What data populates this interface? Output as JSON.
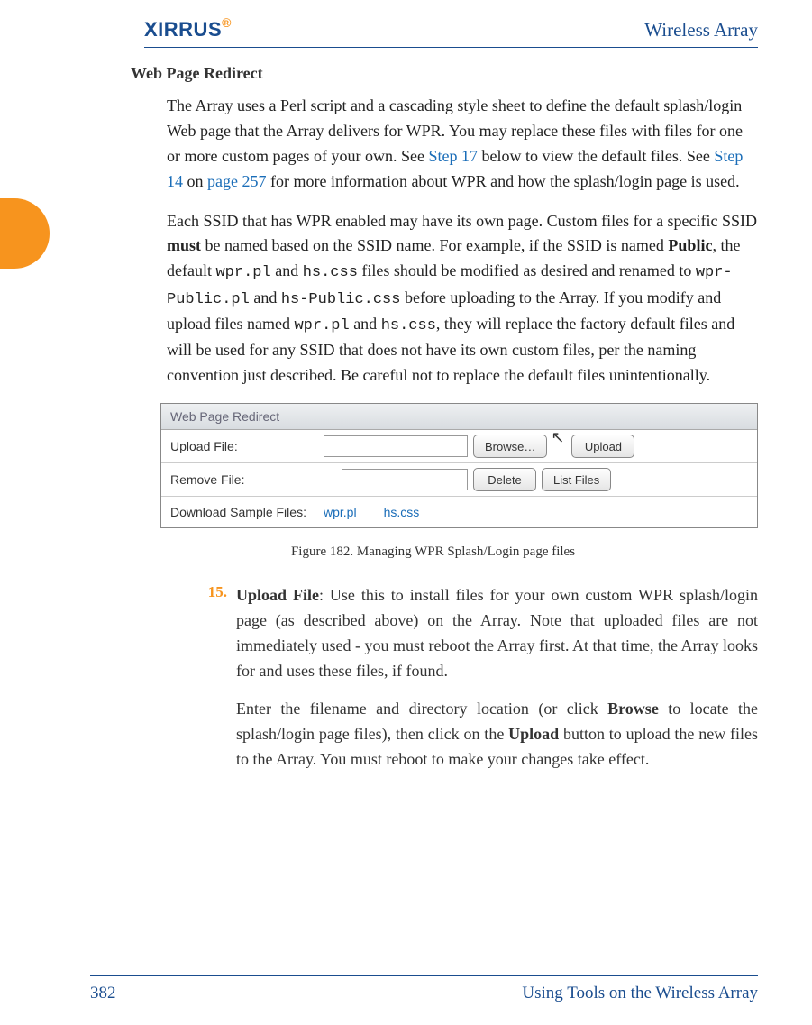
{
  "header": {
    "logo_text": "XIRRUS",
    "doc_title": "Wireless Array"
  },
  "section": {
    "heading": "Web Page Redirect",
    "para1_a": "The Array uses a Perl script and a cascading style sheet to define the default splash/login Web page that the Array delivers for WPR. You may replace these files with files for one or more custom pages of your own. See ",
    "para1_link1": "Step 17",
    "para1_b": " below to view the default files. See ",
    "para1_link2": "Step 14",
    "para1_c": " on ",
    "para1_link3": "page 257",
    "para1_d": " for more information about WPR and how the splash/login page is used.",
    "para2_a": "Each SSID that has WPR enabled may have its own page. Custom files for a specific SSID ",
    "para2_bold1": "must",
    "para2_b": " be named based on the SSID name. For example, if the SSID is named ",
    "para2_bold2": "Public",
    "para2_c": ", the default ",
    "para2_code1": "wpr.pl",
    "para2_d": " and ",
    "para2_code2": "hs.css",
    "para2_e": " files should be modified as desired and renamed to ",
    "para2_code3": "wpr-Public.pl",
    "para2_f": " and ",
    "para2_code4": "hs-Public.css",
    "para2_g": " before uploading to the Array. If you modify and upload files named ",
    "para2_code5": "wpr.pl",
    "para2_h": " and ",
    "para2_code6": "hs.css",
    "para2_i": ", they will replace the factory default files and will be used for any SSID that does not have its own custom files, per the naming convention just described. Be careful not to replace the default files unintentionally."
  },
  "figure": {
    "panel_title": "Web Page Redirect",
    "row1_label": "Upload File:",
    "row1_browse": "Browse…",
    "row1_upload": "Upload",
    "row2_label": "Remove File:",
    "row2_delete": "Delete",
    "row2_list": "List Files",
    "row3_label": "Download Sample Files:",
    "row3_link1": "wpr.pl",
    "row3_link2": "hs.css",
    "caption": "Figure 182. Managing WPR Splash/Login page files"
  },
  "list": {
    "item15_num": "15.",
    "item15_title": "Upload File",
    "item15_p1": ": Use this to install files for your own custom WPR splash/login page (as described above) on the Array. Note that uploaded files are not immediately used - you must reboot the Array first. At that time, the Array looks for and uses these files, if found.",
    "item15_p2_a": "Enter the filename and directory location (or click ",
    "item15_p2_bold1": "Browse",
    "item15_p2_b": " to locate the splash/login page files), then click on the ",
    "item15_p2_bold2": "Upload",
    "item15_p2_c": " button to upload the new files to the Array. You must reboot to make your changes take effect."
  },
  "footer": {
    "page_number": "382",
    "section_name": "Using Tools on the Wireless Array"
  }
}
